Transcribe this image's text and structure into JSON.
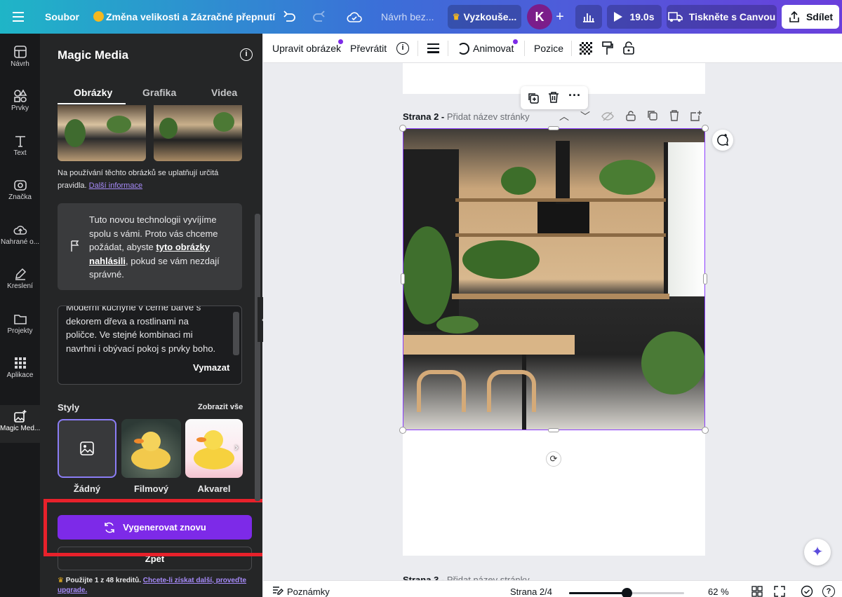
{
  "topbar": {
    "file_menu": "Soubor",
    "resize_magic": "Změna velikosti a Zázračné přepnutí",
    "doc_title": "Návrh bez...",
    "try_button": "Vyzkouše...",
    "avatar_initial": "K",
    "play_time": "19.0s",
    "print_button": "Tiskněte s Canvou",
    "share_button": "Sdílet"
  },
  "rail": {
    "items": [
      "Návrh",
      "Prvky",
      "Text",
      "Značka",
      "Nahrané o...",
      "Kreslení",
      "Projekty",
      "Aplikace",
      "Magic Med..."
    ]
  },
  "panel": {
    "title": "Magic Media",
    "tabs": [
      "Obrázky",
      "Grafika",
      "Videa"
    ],
    "rules_text": "Na používání těchto obrázků se uplatňují určitá pravidla.",
    "rules_link": "Další informace",
    "notice_pre": "Tuto novou technologii vyvíjíme spolu s vámi. Proto vás chceme požádat, abyste ",
    "notice_link": "tyto obrázky nahlásili",
    "notice_post": ", pokud se vám nezdají správné.",
    "prompt_line1": "Moderní kuchyně v černé barvě s",
    "prompt_line2": "dekorem dřeva a rostlinami na",
    "prompt_line3": "poličce. Ve stejné kombinaci mi",
    "prompt_line4": "navrhni i obývací pokoj s prvky boho.",
    "clear_button": "Vymazat",
    "styles_label": "Styly",
    "show_all": "Zobrazit vše",
    "styles": [
      "Žádný",
      "Filmový",
      "Akvarel"
    ],
    "regenerate_button": "Vygenerovat znovu",
    "back_button": "Zpět",
    "credits_text": "Použijte 1 z 48 kreditů.",
    "credits_link": "Chcete-li získat další, proveďte upgrade."
  },
  "context_toolbar": {
    "edit_image": "Upravit obrázek",
    "flip": "Převrátit",
    "animate": "Animovat",
    "position": "Pozice"
  },
  "canvas": {
    "page2_label": "Strana 2 -",
    "page2_placeholder": "Přidat název stránky",
    "page3_label": "Strana 3 -",
    "page3_placeholder": "Přidat název stránky"
  },
  "bottombar": {
    "notes": "Poznámky",
    "page_indicator": "Strana 2/4",
    "zoom_percent": "62 %",
    "zoom_value": 0.62
  },
  "colors": {
    "accent": "#7d2ae8",
    "highlight_red": "#e8212b",
    "panel_bg": "#252627",
    "rail_bg": "#18191b"
  }
}
